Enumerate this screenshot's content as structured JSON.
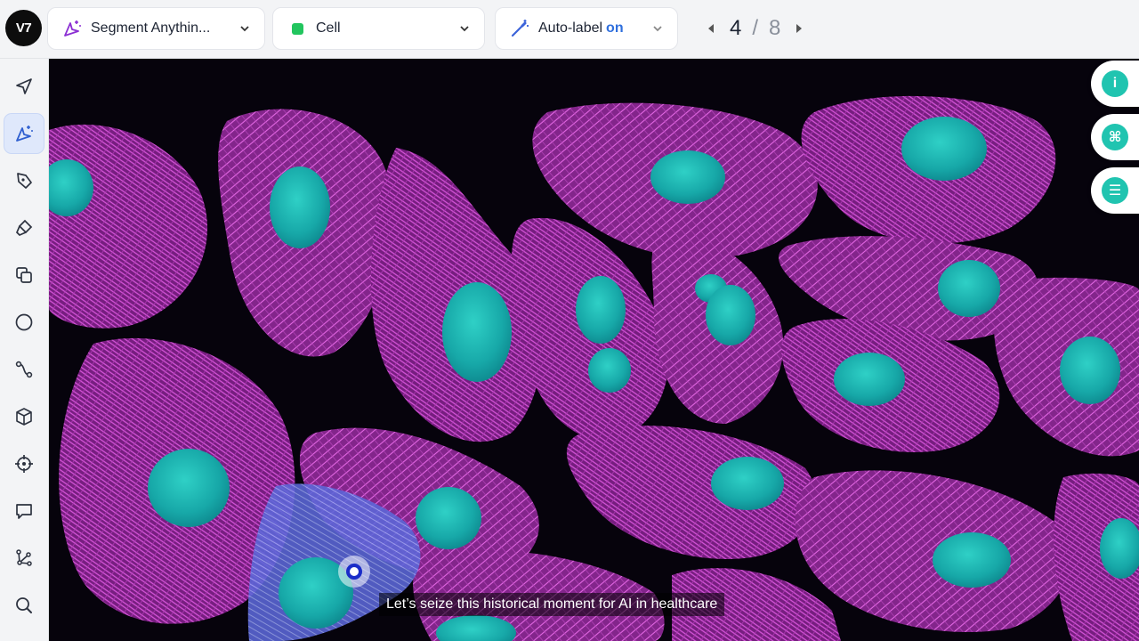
{
  "app": {
    "logo": "V7"
  },
  "toolbar": {
    "model_dropdown": {
      "label": "Segment Anythin...",
      "icon": "magic-cursor-icon"
    },
    "class_dropdown": {
      "label": "Cell",
      "color": "#22c55e"
    },
    "autolabel": {
      "label": "Auto-label",
      "state": "on"
    },
    "pager": {
      "current": "4",
      "separator": "/",
      "total": "8"
    }
  },
  "left_tools": [
    {
      "name": "select-arrow-icon"
    },
    {
      "name": "auto-annotate-icon",
      "active": true
    },
    {
      "name": "polygon-pen-icon"
    },
    {
      "name": "brush-icon"
    },
    {
      "name": "bounding-box-icon"
    },
    {
      "name": "ellipse-icon"
    },
    {
      "name": "polyline-icon"
    },
    {
      "name": "cuboid-icon"
    },
    {
      "name": "keypoint-icon"
    },
    {
      "name": "comment-icon"
    },
    {
      "name": "skeleton-icon"
    },
    {
      "name": "zoom-icon"
    }
  ],
  "right_buttons": [
    {
      "name": "info-icon",
      "glyph": "i"
    },
    {
      "name": "shortcut-icon",
      "glyph": "⌘"
    },
    {
      "name": "settings-sliders-icon",
      "glyph": "☰"
    }
  ],
  "caption": "Let’s seize this historical moment for AI in healthcare",
  "colors": {
    "cytoskeleton": "#c23bc7",
    "nucleus": "#19b2b0",
    "selection": "#5a6fe0",
    "accent": "#2f6fdd"
  }
}
